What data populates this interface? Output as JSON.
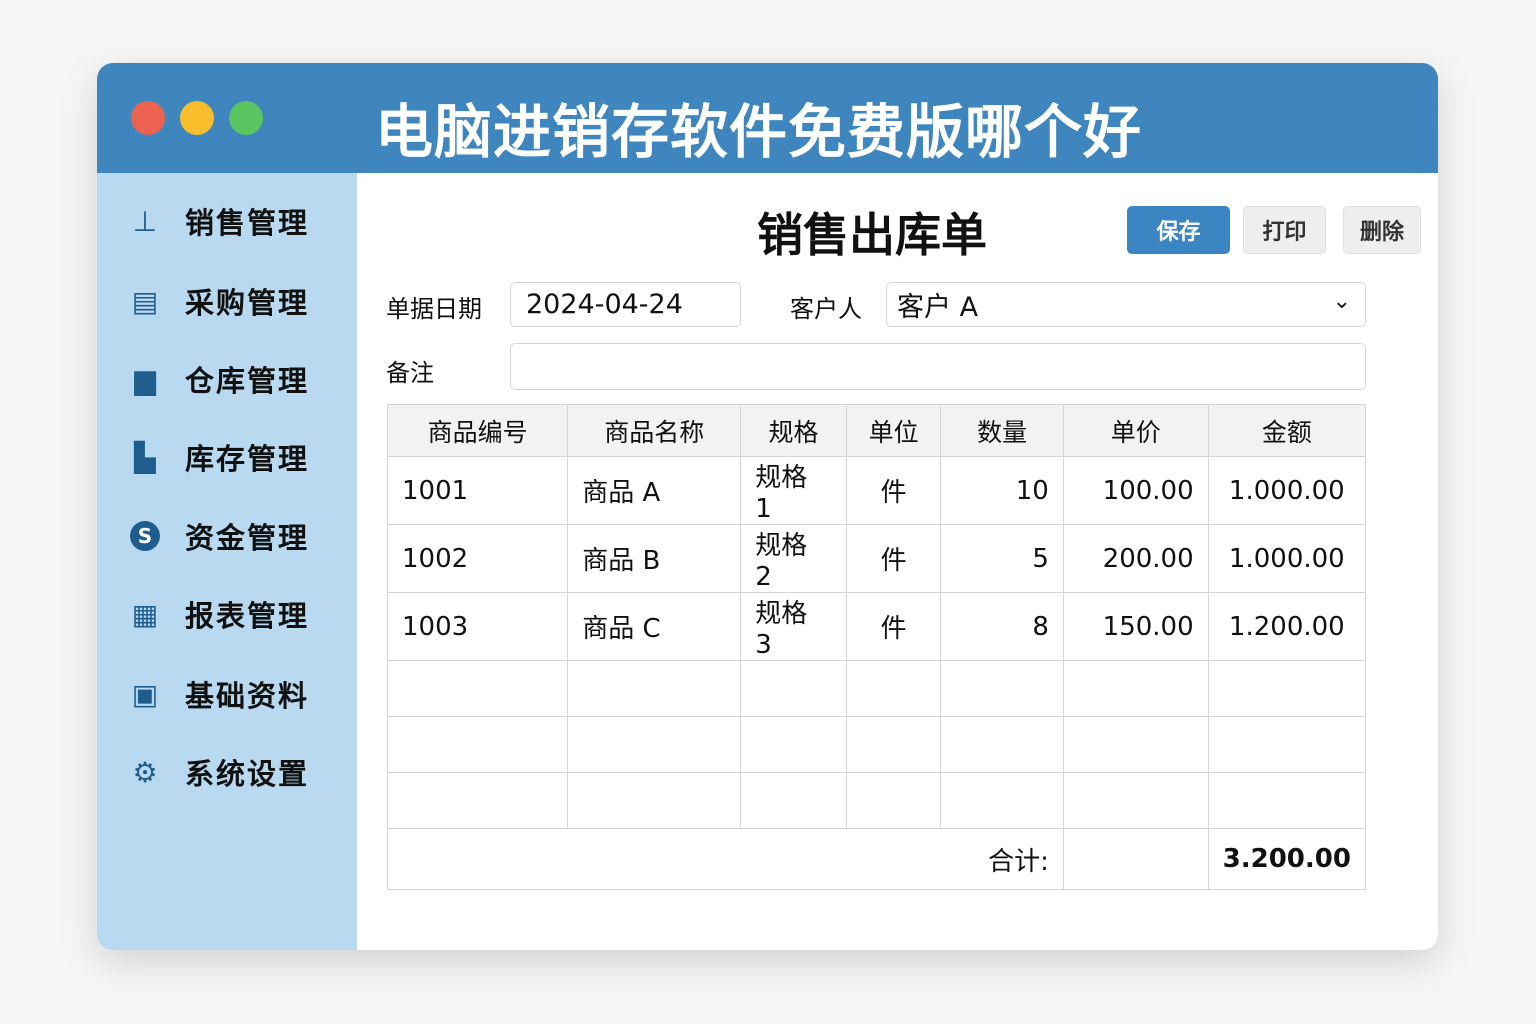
{
  "window": {
    "title": "电脑进销存软件免费版哪个好"
  },
  "sidebar": {
    "items": [
      {
        "label": "销售管理",
        "icon": "sales-icon"
      },
      {
        "label": "采购管理",
        "icon": "purchase-icon"
      },
      {
        "label": "仓库管理",
        "icon": "warehouse-icon"
      },
      {
        "label": "库存管理",
        "icon": "inventory-icon"
      },
      {
        "label": "资金管理",
        "icon": "money-icon"
      },
      {
        "label": "报表管理",
        "icon": "report-icon"
      },
      {
        "label": "基础资料",
        "icon": "contact-icon"
      },
      {
        "label": "系统设置",
        "icon": "gear-icon"
      }
    ]
  },
  "form": {
    "title": "销售出库单",
    "save": "保存",
    "print": "打印",
    "delete": "删除",
    "date_label": "单据日期",
    "date_value": "2024-04-24",
    "customer_label": "客户人",
    "customer_value": "客户 A",
    "note_label": "备注",
    "note_value": ""
  },
  "table": {
    "headers": [
      "商品编号",
      "商品名称",
      "规格",
      "单位",
      "数量",
      "单价",
      "金额"
    ],
    "rows": [
      [
        "1001",
        "商品 A",
        "规格 1",
        "件",
        "10",
        "100.00",
        "1.000.00"
      ],
      [
        "1002",
        "商品 B",
        "规格 2",
        "件",
        "5",
        "200.00",
        "1.000.00"
      ],
      [
        "1003",
        "商品 C",
        "规格 3",
        "件",
        "8",
        "150.00",
        "1.200.00"
      ]
    ],
    "total_label": "合计:",
    "total_value": "3.200.00"
  },
  "colors": {
    "header": "#3f86bf",
    "sidebar": "#b8d9f0",
    "accent": "#3a85c2"
  }
}
